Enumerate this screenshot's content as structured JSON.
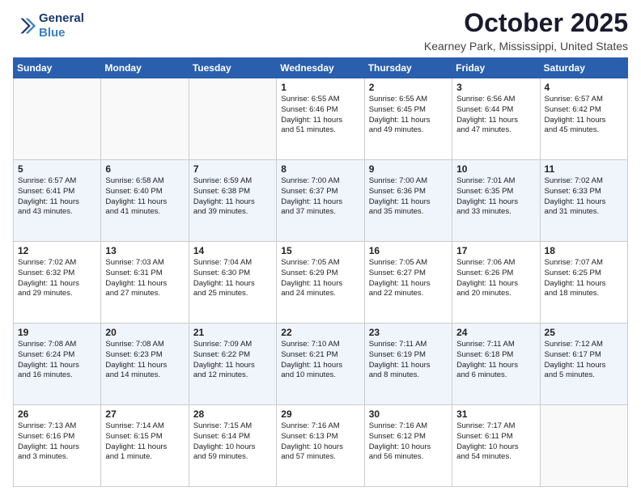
{
  "header": {
    "logo_line1": "General",
    "logo_line2": "Blue",
    "month": "October 2025",
    "location": "Kearney Park, Mississippi, United States"
  },
  "days_of_week": [
    "Sunday",
    "Monday",
    "Tuesday",
    "Wednesday",
    "Thursday",
    "Friday",
    "Saturday"
  ],
  "weeks": [
    [
      {
        "day": "",
        "info": ""
      },
      {
        "day": "",
        "info": ""
      },
      {
        "day": "",
        "info": ""
      },
      {
        "day": "1",
        "info": "Sunrise: 6:55 AM\nSunset: 6:46 PM\nDaylight: 11 hours\nand 51 minutes."
      },
      {
        "day": "2",
        "info": "Sunrise: 6:55 AM\nSunset: 6:45 PM\nDaylight: 11 hours\nand 49 minutes."
      },
      {
        "day": "3",
        "info": "Sunrise: 6:56 AM\nSunset: 6:44 PM\nDaylight: 11 hours\nand 47 minutes."
      },
      {
        "day": "4",
        "info": "Sunrise: 6:57 AM\nSunset: 6:42 PM\nDaylight: 11 hours\nand 45 minutes."
      }
    ],
    [
      {
        "day": "5",
        "info": "Sunrise: 6:57 AM\nSunset: 6:41 PM\nDaylight: 11 hours\nand 43 minutes."
      },
      {
        "day": "6",
        "info": "Sunrise: 6:58 AM\nSunset: 6:40 PM\nDaylight: 11 hours\nand 41 minutes."
      },
      {
        "day": "7",
        "info": "Sunrise: 6:59 AM\nSunset: 6:38 PM\nDaylight: 11 hours\nand 39 minutes."
      },
      {
        "day": "8",
        "info": "Sunrise: 7:00 AM\nSunset: 6:37 PM\nDaylight: 11 hours\nand 37 minutes."
      },
      {
        "day": "9",
        "info": "Sunrise: 7:00 AM\nSunset: 6:36 PM\nDaylight: 11 hours\nand 35 minutes."
      },
      {
        "day": "10",
        "info": "Sunrise: 7:01 AM\nSunset: 6:35 PM\nDaylight: 11 hours\nand 33 minutes."
      },
      {
        "day": "11",
        "info": "Sunrise: 7:02 AM\nSunset: 6:33 PM\nDaylight: 11 hours\nand 31 minutes."
      }
    ],
    [
      {
        "day": "12",
        "info": "Sunrise: 7:02 AM\nSunset: 6:32 PM\nDaylight: 11 hours\nand 29 minutes."
      },
      {
        "day": "13",
        "info": "Sunrise: 7:03 AM\nSunset: 6:31 PM\nDaylight: 11 hours\nand 27 minutes."
      },
      {
        "day": "14",
        "info": "Sunrise: 7:04 AM\nSunset: 6:30 PM\nDaylight: 11 hours\nand 25 minutes."
      },
      {
        "day": "15",
        "info": "Sunrise: 7:05 AM\nSunset: 6:29 PM\nDaylight: 11 hours\nand 24 minutes."
      },
      {
        "day": "16",
        "info": "Sunrise: 7:05 AM\nSunset: 6:27 PM\nDaylight: 11 hours\nand 22 minutes."
      },
      {
        "day": "17",
        "info": "Sunrise: 7:06 AM\nSunset: 6:26 PM\nDaylight: 11 hours\nand 20 minutes."
      },
      {
        "day": "18",
        "info": "Sunrise: 7:07 AM\nSunset: 6:25 PM\nDaylight: 11 hours\nand 18 minutes."
      }
    ],
    [
      {
        "day": "19",
        "info": "Sunrise: 7:08 AM\nSunset: 6:24 PM\nDaylight: 11 hours\nand 16 minutes."
      },
      {
        "day": "20",
        "info": "Sunrise: 7:08 AM\nSunset: 6:23 PM\nDaylight: 11 hours\nand 14 minutes."
      },
      {
        "day": "21",
        "info": "Sunrise: 7:09 AM\nSunset: 6:22 PM\nDaylight: 11 hours\nand 12 minutes."
      },
      {
        "day": "22",
        "info": "Sunrise: 7:10 AM\nSunset: 6:21 PM\nDaylight: 11 hours\nand 10 minutes."
      },
      {
        "day": "23",
        "info": "Sunrise: 7:11 AM\nSunset: 6:19 PM\nDaylight: 11 hours\nand 8 minutes."
      },
      {
        "day": "24",
        "info": "Sunrise: 7:11 AM\nSunset: 6:18 PM\nDaylight: 11 hours\nand 6 minutes."
      },
      {
        "day": "25",
        "info": "Sunrise: 7:12 AM\nSunset: 6:17 PM\nDaylight: 11 hours\nand 5 minutes."
      }
    ],
    [
      {
        "day": "26",
        "info": "Sunrise: 7:13 AM\nSunset: 6:16 PM\nDaylight: 11 hours\nand 3 minutes."
      },
      {
        "day": "27",
        "info": "Sunrise: 7:14 AM\nSunset: 6:15 PM\nDaylight: 11 hours\nand 1 minute."
      },
      {
        "day": "28",
        "info": "Sunrise: 7:15 AM\nSunset: 6:14 PM\nDaylight: 10 hours\nand 59 minutes."
      },
      {
        "day": "29",
        "info": "Sunrise: 7:16 AM\nSunset: 6:13 PM\nDaylight: 10 hours\nand 57 minutes."
      },
      {
        "day": "30",
        "info": "Sunrise: 7:16 AM\nSunset: 6:12 PM\nDaylight: 10 hours\nand 56 minutes."
      },
      {
        "day": "31",
        "info": "Sunrise: 7:17 AM\nSunset: 6:11 PM\nDaylight: 10 hours\nand 54 minutes."
      },
      {
        "day": "",
        "info": ""
      }
    ]
  ]
}
